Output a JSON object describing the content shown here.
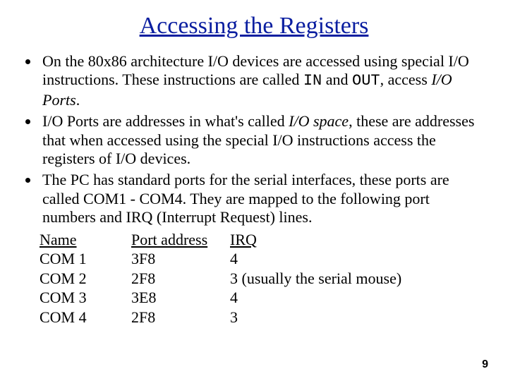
{
  "title": "Accessing the Registers",
  "bullets": {
    "b1a": "On the 80x86 architecture I/O devices are accessed using special I/O instructions. These instructions are called ",
    "b1_in": "IN",
    "b1b": " and ",
    "b1_out": "OUT",
    "b1c": ", access ",
    "b1_ioports": "I/O Ports",
    "b1d": ".",
    "b2a": "I/O Ports are addresses in what's called ",
    "b2_iospace": "I/O space",
    "b2b": ", these are addresses that when accessed using the special I/O instructions access the registers of I/O devices.",
    "b3": "The PC has standard ports for the serial interfaces, these ports are called COM1 - COM4. They are mapped to the following port numbers and IRQ (Interrupt Request) lines."
  },
  "table": {
    "headers": {
      "c1": "Name",
      "c2": "Port address",
      "c3": "IRQ"
    },
    "rows": [
      {
        "c1": "COM 1",
        "c2": "3F8",
        "c3": "4"
      },
      {
        "c1": "COM 2",
        "c2": "2F8",
        "c3": "3  (usually the serial mouse)"
      },
      {
        "c1": "COM 3",
        "c2": "3E8",
        "c3": "4"
      },
      {
        "c1": "COM 4",
        "c2": "2F8",
        "c3": "3"
      }
    ]
  },
  "page_number": "9"
}
